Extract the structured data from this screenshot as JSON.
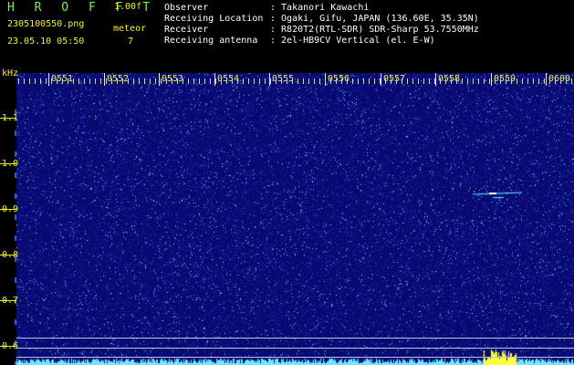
{
  "header": {
    "brand": "H R O F F T",
    "version": "1.00f",
    "file": "2305100550.png",
    "datetime": "23.05.10 05:50",
    "meteor_label": "meteor",
    "meteor_count": "7",
    "info": [
      {
        "key": "Observer",
        "value": ": Takanori Kawachi"
      },
      {
        "key": "Receiving Location",
        "value": ": Ogaki, Gifu, JAPAN (136.60E, 35.35N)"
      },
      {
        "key": "Receiver",
        "value": ": R820T2(RTL-SDR) SDR-Sharp 53.7550MHz"
      },
      {
        "key": "Receiving antenna",
        "value": ": 2el-HB9CV Vertical (el. E-W)"
      }
    ]
  },
  "time_axis": [
    "0551",
    "0552",
    "0553",
    "0554",
    "0555",
    "0556",
    "0557",
    "0558",
    "0559",
    "0600"
  ],
  "freq_axis": {
    "unit": "kHz",
    "labels": [
      "1.1",
      "1.0",
      "0.9",
      "0.8",
      "0.7",
      "0.6"
    ]
  },
  "colors": {
    "background": "#0a0a70",
    "text": "#f2ef2a",
    "signal": "#6fe8ff",
    "hot": "#ffff40"
  }
}
